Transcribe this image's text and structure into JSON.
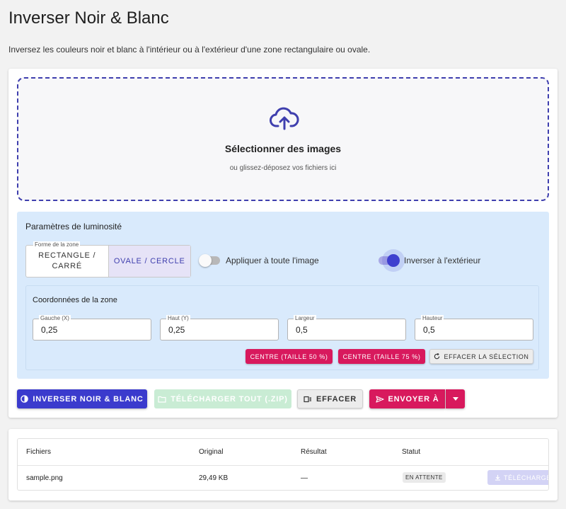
{
  "page": {
    "title": "Inverser Noir & Blanc",
    "subtitle": "Inversez les couleurs noir et blanc à l'intérieur ou à l'extérieur d'une zone rectangulaire ou ovale."
  },
  "dropzone": {
    "icon": "cloud-upload-icon",
    "title": "Sélectionner des images",
    "subtitle": "ou glissez-déposez vos fichiers ici"
  },
  "settings": {
    "title": "Paramètres de luminosité",
    "shape": {
      "legend": "Forme de la zone",
      "options": [
        "RECTANGLE / CARRÉ",
        "OVALE / CERCLE"
      ],
      "selected": "OVALE / CERCLE"
    },
    "apply_all": {
      "label": "Appliquer à toute l'image",
      "checked": false
    },
    "invert_outside": {
      "label": "Inverser à l'extérieur",
      "checked": true
    },
    "coords": {
      "title": "Coordonnées de la zone",
      "fields": [
        {
          "label": "Gauche (X)",
          "value": "0,25"
        },
        {
          "label": "Haut (Y)",
          "value": "0,25"
        },
        {
          "label": "Largeur",
          "value": "0,5"
        },
        {
          "label": "Hauteur",
          "value": "0,5"
        }
      ],
      "center50": "CENTRE (TAILLE 50 %)",
      "center75": "CENTRE (TAILLE 75 %)",
      "clear_selection": "EFFACER LA SÉLECTION"
    }
  },
  "actions": {
    "invert": "INVERSER NOIR & BLANC",
    "download_zip": "TÉLÉCHARGER TOUT (.ZIP)",
    "clear": "EFFACER",
    "send": "ENVOYER À"
  },
  "table": {
    "headers": [
      "Fichiers",
      "Original",
      "Résultat",
      "Statut"
    ],
    "rows": [
      {
        "file": "sample.png",
        "original": "29,49 KB",
        "result": "—",
        "status": "EN ATTENTE",
        "action": "TÉLÉCHARGER"
      }
    ]
  },
  "colors": {
    "primary": "#3b3bcd",
    "accent_pink": "#d8195d",
    "panel_bg": "#d9eafc",
    "zip_disabled": "#c9ecd4"
  }
}
